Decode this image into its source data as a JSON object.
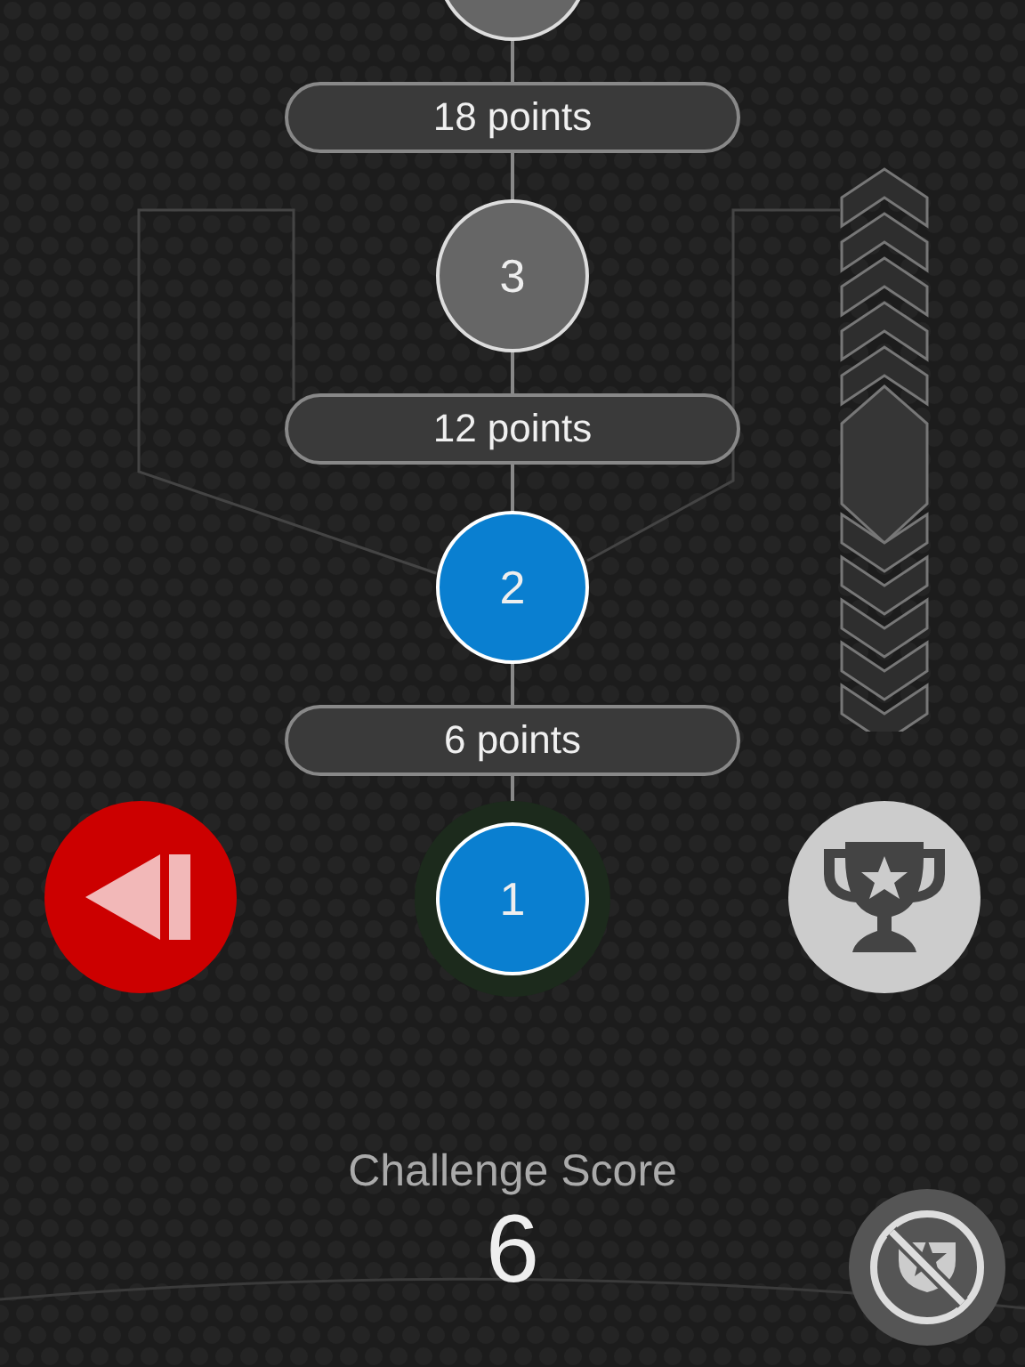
{
  "ladder": {
    "nodes": [
      {
        "cleared": false,
        "current": false
      },
      {
        "number": "3",
        "cleared": false,
        "current": false
      },
      {
        "number": "2",
        "cleared": true,
        "current": false
      },
      {
        "number": "1",
        "cleared": true,
        "current": true
      }
    ],
    "thresholds": [
      "18 points",
      "12 points",
      "6 points"
    ]
  },
  "score": {
    "label": "Challenge Score",
    "value": "6"
  }
}
